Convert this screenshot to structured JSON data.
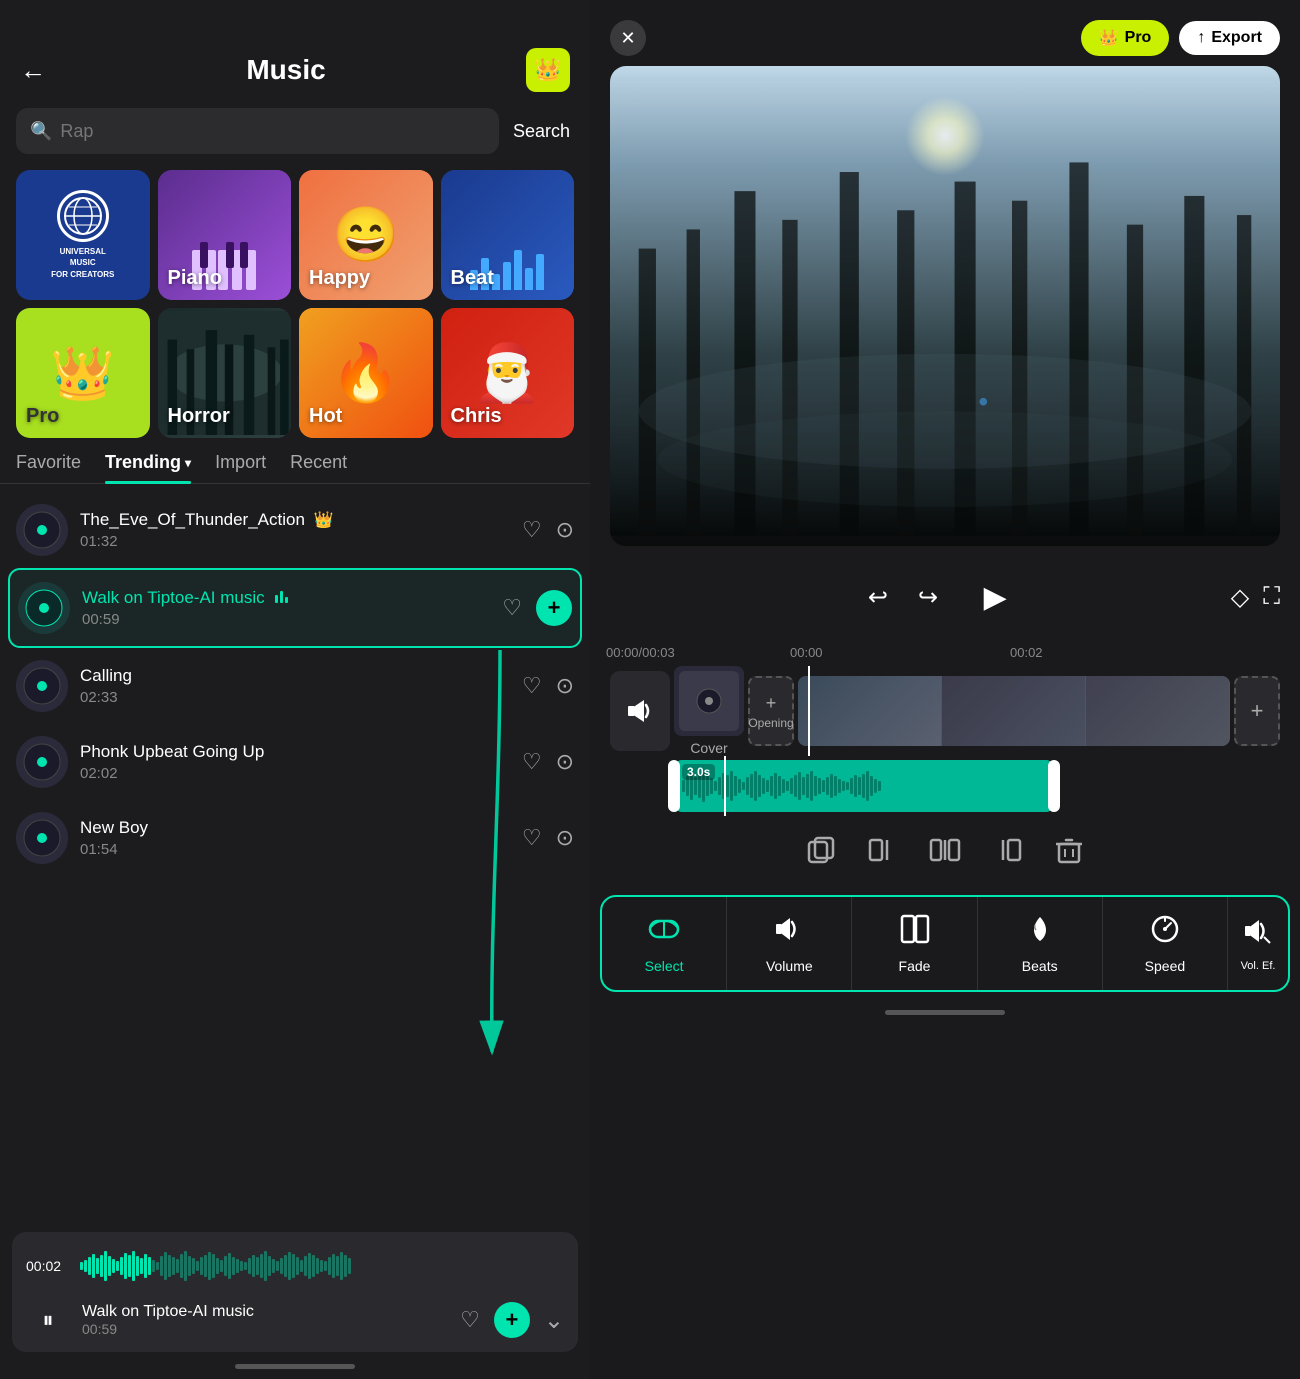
{
  "app": {
    "title": "Music",
    "back_label": "←",
    "close_label": "✕"
  },
  "pro_badge": {
    "label": "👑 Pro",
    "crown": "👑"
  },
  "export": {
    "label": "↑ Export"
  },
  "search": {
    "placeholder": "Rap",
    "button_label": "Search"
  },
  "categories": [
    {
      "id": "universal",
      "label": "",
      "type": "universal"
    },
    {
      "id": "piano",
      "label": "Piano",
      "type": "piano"
    },
    {
      "id": "happy",
      "label": "Happy",
      "type": "happy"
    },
    {
      "id": "beat",
      "label": "Beat",
      "type": "beat"
    },
    {
      "id": "pro",
      "label": "Pro",
      "type": "pro"
    },
    {
      "id": "horror",
      "label": "Horror",
      "type": "horror"
    },
    {
      "id": "hot",
      "label": "Hot",
      "type": "hot"
    },
    {
      "id": "christmas",
      "label": "Chris",
      "type": "christmas"
    }
  ],
  "tabs": [
    {
      "id": "favorite",
      "label": "Favorite",
      "active": false
    },
    {
      "id": "trending",
      "label": "Trending",
      "active": true
    },
    {
      "id": "import",
      "label": "Import",
      "active": false
    },
    {
      "id": "recent",
      "label": "Recent",
      "active": false
    }
  ],
  "songs": [
    {
      "id": 1,
      "name": "The_Eve_Of_Thunder_Action",
      "duration": "01:32",
      "pro": true,
      "active": false
    },
    {
      "id": 2,
      "name": "Walk on Tiptoe-AI music",
      "duration": "00:59",
      "pro": false,
      "active": true,
      "playing": true
    },
    {
      "id": 3,
      "name": "Calling",
      "duration": "02:33",
      "pro": false,
      "active": false
    },
    {
      "id": 4,
      "name": "Phonk Upbeat Going Up",
      "duration": "02:02",
      "pro": false,
      "active": false
    },
    {
      "id": 5,
      "name": "New Boy",
      "duration": "01:54",
      "pro": false,
      "active": false
    }
  ],
  "player": {
    "current_time": "00:02",
    "song_name": "Walk on Tiptoe-AI music",
    "duration": "00:59"
  },
  "timeline": {
    "current_time": "00:00",
    "total_time": "00:03",
    "marker1": "00:00",
    "marker2": "00:02",
    "cover_label": "Cover",
    "opening_label": "Opening",
    "audio_duration": "3.0s"
  },
  "toolbar": {
    "items": [
      {
        "id": "select",
        "label": "Select",
        "icon": "⇄"
      },
      {
        "id": "volume",
        "label": "Volume",
        "icon": "🔊"
      },
      {
        "id": "fade",
        "label": "Fade",
        "icon": "▣"
      },
      {
        "id": "beats",
        "label": "Beats",
        "icon": "🔥"
      },
      {
        "id": "speed",
        "label": "Speed",
        "icon": "⏱"
      },
      {
        "id": "vol-effects",
        "label": "Vol. Ef.",
        "icon": "🔊"
      }
    ]
  },
  "edit_actions": [
    {
      "id": "duplicate",
      "icon": "⧉",
      "label": ""
    },
    {
      "id": "split-left",
      "icon": "⊣",
      "label": ""
    },
    {
      "id": "split",
      "icon": "⊢⊣",
      "label": ""
    },
    {
      "id": "split-right",
      "icon": "⊢",
      "label": ""
    },
    {
      "id": "delete",
      "icon": "🗑",
      "label": ""
    }
  ]
}
